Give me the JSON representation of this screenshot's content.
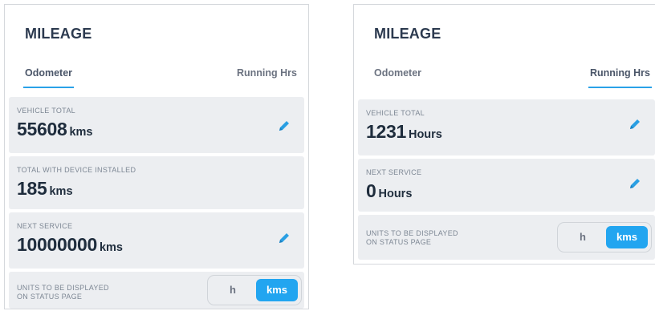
{
  "left_panel": {
    "title": "MILEAGE",
    "tabs": [
      {
        "label": "Odometer",
        "active": true
      },
      {
        "label": "Running Hrs",
        "active": false
      }
    ],
    "cards": [
      {
        "label": "VEHICLE TOTAL",
        "value": "55608",
        "unit": "kms",
        "editable": true
      },
      {
        "label": "TOTAL WITH DEVICE INSTALLED",
        "value": "185",
        "unit": "kms",
        "editable": false
      },
      {
        "label": "NEXT SERVICE",
        "value": "10000000",
        "unit": "kms",
        "editable": true
      }
    ],
    "units": {
      "label_line1": "UNITS TO BE DISPLAYED",
      "label_line2": "ON STATUS PAGE",
      "options": [
        "h",
        "kms"
      ],
      "selected": "kms"
    }
  },
  "right_panel": {
    "title": "MILEAGE",
    "tabs": [
      {
        "label": "Odometer",
        "active": false
      },
      {
        "label": "Running Hrs",
        "active": true
      }
    ],
    "cards": [
      {
        "label": "VEHICLE TOTAL",
        "value": "1231",
        "unit": "Hours",
        "editable": true
      },
      {
        "label": "NEXT SERVICE",
        "value": "0",
        "unit": "Hours",
        "editable": true
      }
    ],
    "units": {
      "label_line1": "UNITS TO BE DISPLAYED",
      "label_line2": "ON STATUS PAGE",
      "options": [
        "h",
        "kms"
      ],
      "selected": "kms"
    }
  },
  "colors": {
    "accent": "#22a5f0",
    "card_bg": "#eceef1",
    "title": "#2c3a4f",
    "value": "#1f2d3d"
  },
  "icons": {
    "edit": "pencil-icon"
  }
}
